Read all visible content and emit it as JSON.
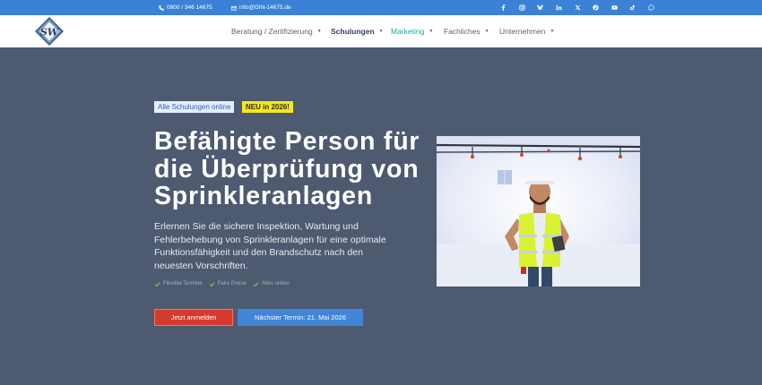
{
  "topbar": {
    "phone": "0800 / 346 14675",
    "email": "info@DIN-14675.de",
    "social_icons": [
      "facebook-icon",
      "instagram-icon",
      "bluesky-icon",
      "linkedin-icon",
      "x-icon",
      "pinterest-icon",
      "youtube-icon",
      "tiktok-icon",
      "whatsapp-icon"
    ]
  },
  "header": {
    "logo_text": "SW",
    "nav": [
      {
        "label": "Beratung / Zertifizierung"
      },
      {
        "label": "Schulungen"
      },
      {
        "label": "Marketing"
      },
      {
        "label": "Fachliches"
      },
      {
        "label": "Unternehmen"
      }
    ]
  },
  "hero": {
    "badge_online": "Alle Schulungen online",
    "badge_new": "NEU in 2026!",
    "title": "Befähigte Person für die Überprüfung von Sprinkleranlagen",
    "description": "Erlernen Sie die sichere Inspektion, Wartung und Fehlerbehebung von Sprinkleranlagen für eine optimale Funktionsfähigkeit und den Brandschutz nach den neuesten Vorschriften.",
    "features": [
      "Flexible Termine",
      "Faire Preise",
      "Alles online"
    ],
    "cta_primary": "Jetzt anmelden",
    "cta_secondary": "Nächster Termin: 21. Mai 2026"
  },
  "colors": {
    "topbar": "#3b82d6",
    "hero_bg": "#4d5a70",
    "cta_red": "#d43a2f",
    "cta_blue": "#4285d6",
    "badge_yellow": "#f8e71c",
    "check_green": "#8bc34a"
  }
}
